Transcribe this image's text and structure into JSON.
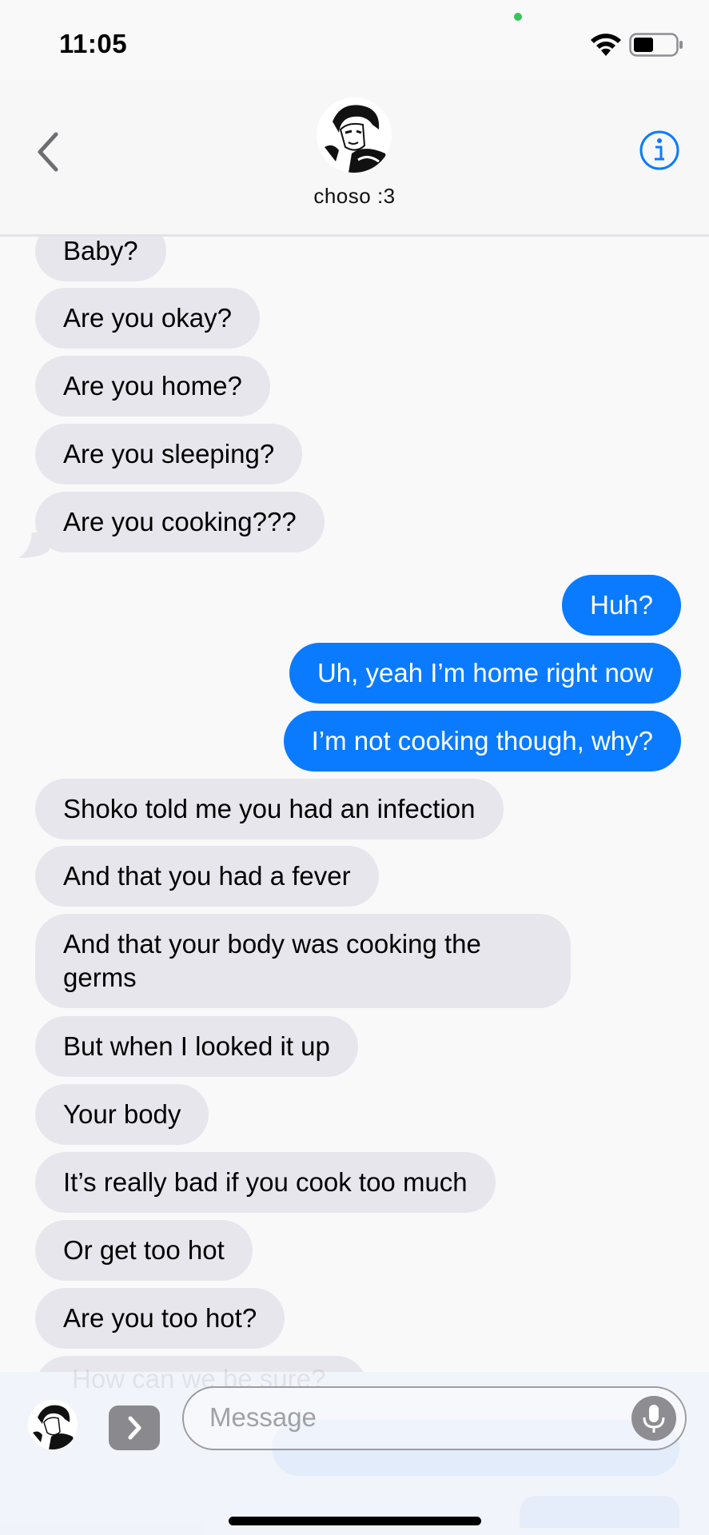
{
  "status_bar": {
    "time": "11:05",
    "icons": [
      "wifi-icon",
      "battery-icon"
    ]
  },
  "header": {
    "contact_name": "choso :3",
    "back_icon": "chevron-left-icon",
    "info_icon": "info-circle-icon"
  },
  "messages": [
    {
      "from": "them",
      "text": "Baby?"
    },
    {
      "from": "them",
      "text": "Are you okay?"
    },
    {
      "from": "them",
      "text": "Are you home?"
    },
    {
      "from": "them",
      "text": "Are you sleeping?"
    },
    {
      "from": "them",
      "text": "Are you cooking???"
    },
    {
      "from": "me",
      "text": "Huh?"
    },
    {
      "from": "me",
      "text": "Uh, yeah I’m home right now"
    },
    {
      "from": "me",
      "text": "I’m not cooking though, why?"
    },
    {
      "from": "them",
      "text": "Shoko told me you had an infection"
    },
    {
      "from": "them",
      "text": "And that you had a fever"
    },
    {
      "from": "them",
      "text": "And that your body was cooking the germs"
    },
    {
      "from": "them",
      "text": "But when I looked it up"
    },
    {
      "from": "them",
      "text": "Your body"
    },
    {
      "from": "them",
      "text": "It’s really bad if you cook too much"
    },
    {
      "from": "them",
      "text": "Or get too hot"
    },
    {
      "from": "them",
      "text": "Are you too hot?"
    }
  ],
  "compose": {
    "placeholder": "Message",
    "behind_text": "How can we be sure?",
    "icons": [
      "memoji-icon",
      "chevron-right-icon",
      "microphone-icon"
    ]
  },
  "colors": {
    "incoming_bubble": "#e7e6ec",
    "outgoing_bubble": "#0a7bff",
    "accent": "#0a7bff"
  }
}
